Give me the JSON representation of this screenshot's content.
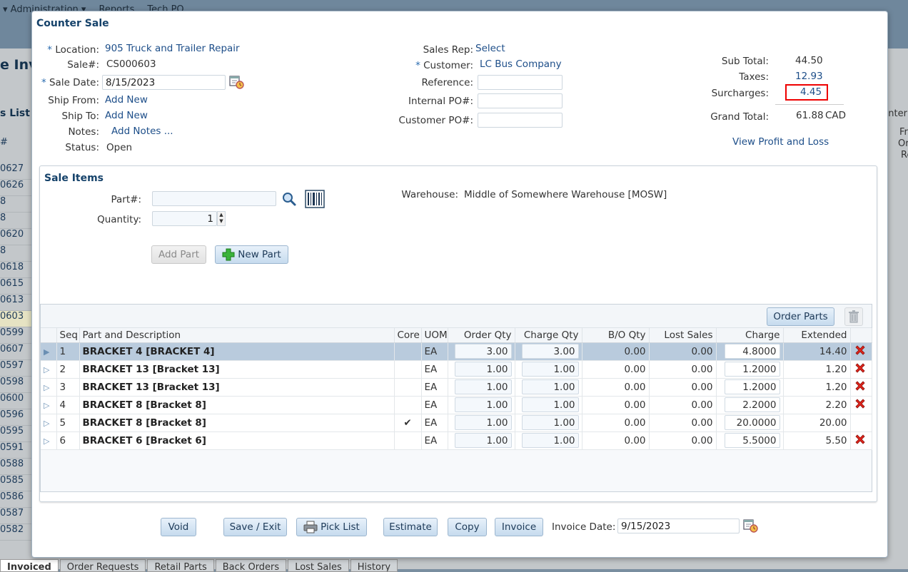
{
  "background": {
    "menu": [
      "Administration ▾",
      "Reports",
      "Tech PO"
    ],
    "page_title": "e Invi",
    "list_label": "s List",
    "rows": [
      "0627",
      "0626",
      "8",
      "8",
      "0620",
      "8",
      "0618",
      "0615",
      "0613",
      "0603",
      "0599",
      "0607",
      "0597",
      "0598",
      "0600",
      "0596",
      "0595",
      "0591",
      "0588",
      "0585",
      "0586",
      "0587",
      "0582"
    ],
    "right_labels": [
      "unter",
      "Fr",
      "Or",
      "Re"
    ],
    "tabs": [
      "Invoiced",
      "Order Requests",
      "Retail Parts",
      "Back Orders",
      "Lost Sales",
      "History"
    ]
  },
  "modal": {
    "title": "Counter Sale",
    "location_label": "Location:",
    "location_value": "905 Truck and Trailer Repair",
    "sale_no_label": "Sale#:",
    "sale_no_value": "CS000603",
    "sale_date_label": "Sale Date:",
    "sale_date_value": "8/15/2023",
    "ship_from_label": "Ship From:",
    "ship_from_value": "Add New",
    "ship_to_label": "Ship To:",
    "ship_to_value": "Add New",
    "notes_label": "Notes:",
    "notes_value": "Add Notes ...",
    "status_label": "Status:",
    "status_value": "Open",
    "sales_rep_label": "Sales Rep:",
    "sales_rep_value": "Select",
    "customer_label": "Customer:",
    "customer_value": "LC Bus Company",
    "reference_label": "Reference:",
    "internal_po_label": "Internal PO#:",
    "customer_po_label": "Customer PO#:",
    "required_mark": "*",
    "totals": {
      "subtotal_label": "Sub Total:",
      "subtotal_value": "44.50",
      "taxes_label": "Taxes:",
      "taxes_value": "12.93",
      "surcharges_label": "Surcharges:",
      "surcharges_value": "4.45",
      "grand_total_label": "Grand Total:",
      "grand_total_value": "61.88",
      "currency": "CAD",
      "profit_loss_link": "View Profit and Loss"
    }
  },
  "sale_items": {
    "title": "Sale Items",
    "part_label": "Part#:",
    "part_value": "",
    "quantity_label": "Quantity:",
    "quantity_value": "1",
    "warehouse_label": "Warehouse:",
    "warehouse_value": "Middle of Somewhere Warehouse [MOSW]",
    "add_part_label": "Add Part",
    "new_part_label": "New Part",
    "order_parts_label": "Order Parts",
    "columns": [
      "Seq",
      "Part and Description",
      "Core",
      "UOM",
      "Order Qty",
      "Charge Qty",
      "B/O Qty",
      "Lost Sales",
      "Charge",
      "Extended"
    ],
    "rows": [
      {
        "seq": "1",
        "part": "BRACKET 4 [BRACKET 4]",
        "core": "",
        "uom": "EA",
        "order_qty": "3.00",
        "charge_qty": "3.00",
        "bo_qty": "0.00",
        "lost_sales": "0.00",
        "charge": "4.8000",
        "extended": "14.40"
      },
      {
        "seq": "2",
        "part": "BRACKET 13 [Bracket 13]",
        "core": "",
        "uom": "EA",
        "order_qty": "1.00",
        "charge_qty": "1.00",
        "bo_qty": "0.00",
        "lost_sales": "0.00",
        "charge": "1.2000",
        "extended": "1.20"
      },
      {
        "seq": "3",
        "part": "BRACKET 13 [Bracket 13]",
        "core": "",
        "uom": "EA",
        "order_qty": "1.00",
        "charge_qty": "1.00",
        "bo_qty": "0.00",
        "lost_sales": "0.00",
        "charge": "1.2000",
        "extended": "1.20"
      },
      {
        "seq": "4",
        "part": "BRACKET 8 [Bracket 8]",
        "core": "",
        "uom": "EA",
        "order_qty": "1.00",
        "charge_qty": "1.00",
        "bo_qty": "0.00",
        "lost_sales": "0.00",
        "charge": "2.2000",
        "extended": "2.20"
      },
      {
        "seq": "5",
        "part": "BRACKET 8 [Bracket 8]",
        "core": "✔",
        "uom": "EA",
        "order_qty": "1.00",
        "charge_qty": "1.00",
        "bo_qty": "0.00",
        "lost_sales": "0.00",
        "charge": "20.0000",
        "extended": "20.00"
      },
      {
        "seq": "6",
        "part": "BRACKET 6 [Bracket 6]",
        "core": "",
        "uom": "EA",
        "order_qty": "1.00",
        "charge_qty": "1.00",
        "bo_qty": "0.00",
        "lost_sales": "0.00",
        "charge": "5.5000",
        "extended": "5.50"
      }
    ]
  },
  "footer": {
    "void_label": "Void",
    "save_exit_label": "Save / Exit",
    "pick_list_label": "Pick List",
    "estimate_label": "Estimate",
    "copy_label": "Copy",
    "invoice_label": "Invoice",
    "invoice_date_label": "Invoice Date:",
    "invoice_date_value": "9/15/2023"
  },
  "colors": {
    "accent": "#15426a",
    "link": "#1d4e89",
    "highlight_box": "#e00000",
    "delete": "#d11"
  }
}
